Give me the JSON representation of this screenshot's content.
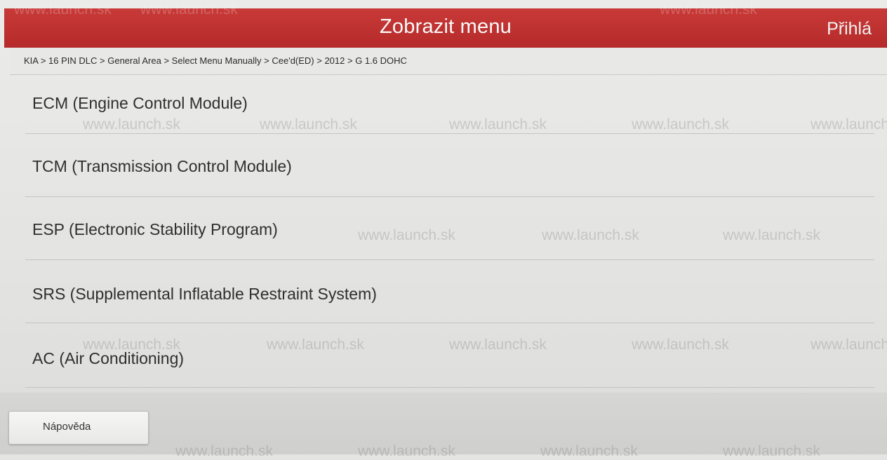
{
  "header": {
    "title": "Zobrazit menu",
    "login_label": "Přihlá"
  },
  "breadcrumb": "KIA > 16 PIN DLC > General Area > Select Menu Manually > Cee'd(ED) > 2012 > G 1.6 DOHC",
  "menu": {
    "items": [
      {
        "label": "ECM (Engine Control Module)"
      },
      {
        "label": "TCM (Transmission Control Module)"
      },
      {
        "label": "ESP (Electronic Stability Program)"
      },
      {
        "label": "SRS (Supplemental Inflatable Restraint System)"
      },
      {
        "label": "AC (Air Conditioning)"
      }
    ]
  },
  "footer": {
    "help_label": "Nápověda"
  },
  "watermark": "www.launch.sk",
  "colors": {
    "header_red": "#b52a2a",
    "background": "#e4e4e2"
  }
}
